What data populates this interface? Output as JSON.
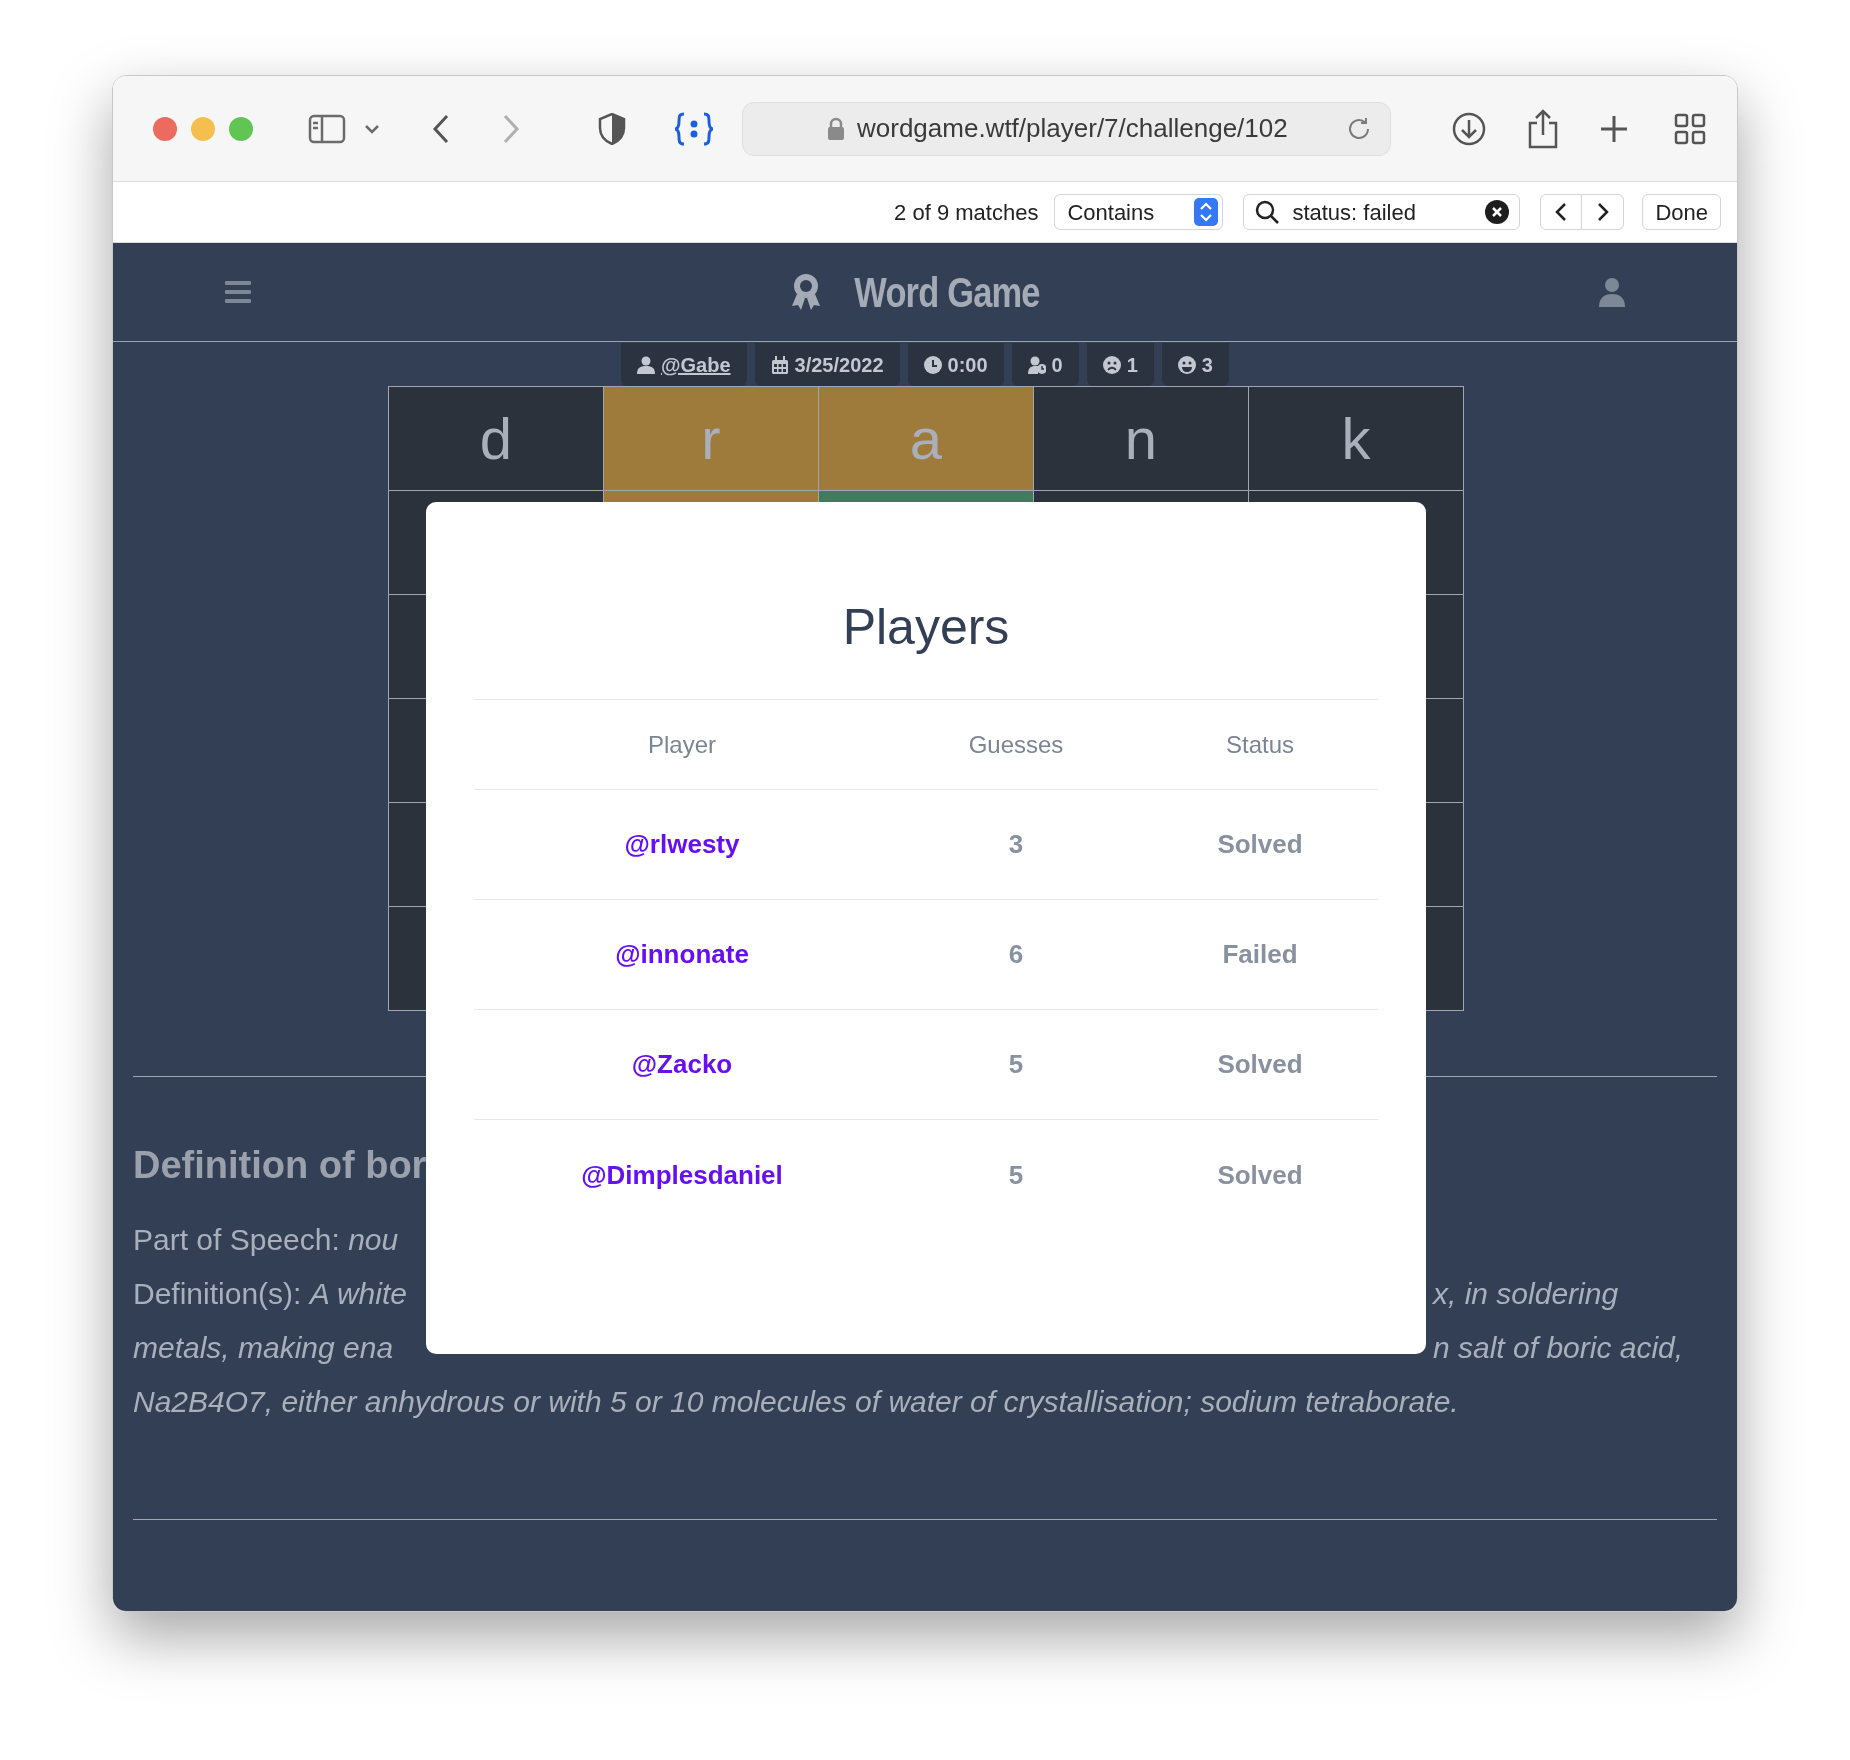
{
  "browser": {
    "url": "wordgame.wtf/player/7/challenge/102"
  },
  "find_bar": {
    "match_count": "2 of 9 matches",
    "mode": "Contains",
    "query": "status: failed",
    "done_label": "Done"
  },
  "app": {
    "title": "Word Game"
  },
  "stats": [
    {
      "kind": "player",
      "text": "@Gabe"
    },
    {
      "kind": "date",
      "text": "3/25/2022"
    },
    {
      "kind": "time",
      "text": "0:00"
    },
    {
      "kind": "waiting",
      "text": "0"
    },
    {
      "kind": "failed",
      "text": "1"
    },
    {
      "kind": "solved",
      "text": "3"
    }
  ],
  "board": {
    "rows": [
      {
        "tiles": [
          {
            "letter": "d",
            "color": "#2c323c"
          },
          {
            "letter": "r",
            "color": "#9e7b3b"
          },
          {
            "letter": "a",
            "color": "#9e7b3b"
          },
          {
            "letter": "n",
            "color": "#2c323c"
          },
          {
            "letter": "k",
            "color": "#2c323c"
          }
        ]
      },
      {
        "tiles": [
          {
            "color": "#2c323c"
          },
          {
            "color": "#9e7b3b"
          },
          {
            "color": "#44795c"
          },
          {
            "color": "#2c323c"
          },
          {
            "color": "#2c323c"
          }
        ]
      },
      {
        "edge_tiles": [
          {
            "color": "#2c323c"
          },
          {
            "color": "#2c323c"
          }
        ]
      },
      {
        "edge_tiles": [
          {
            "color": "#2c323c"
          },
          {
            "color": "#2c323c"
          }
        ]
      },
      {
        "edge_tiles": [
          {
            "color": "#2c323c"
          },
          {
            "color": "#2c323c"
          }
        ]
      },
      {
        "edge_tiles": [
          {
            "color": "#2c323c"
          },
          {
            "color": "#2c323c"
          }
        ]
      }
    ]
  },
  "definition": {
    "heading": "Definition of bor",
    "lines": [
      {
        "left": {
          "text": "Part of Speech: *nou*",
          "italic": false
        }
      },
      {
        "left": {
          "text": "Definition(s): *A white*",
          "italic": false
        },
        "right": {
          "text": "x, in soldering",
          "italic": true
        }
      },
      {
        "left": {
          "text": "metals, making ena",
          "italic": true
        },
        "right": {
          "text": "n salt of boric acid,",
          "italic": true
        }
      },
      {
        "left": {
          "text": "Na2B4O7, either anhydrous or with 5 or 10 molecules of water of crystallisation; sodium tetraborate.",
          "italic": true
        }
      }
    ]
  },
  "players_dialog": {
    "title": "Players",
    "columns": [
      "Player",
      "Guesses",
      "Status"
    ],
    "rows": [
      {
        "player": "@rlwesty",
        "guesses": "3",
        "status": "Solved"
      },
      {
        "player": "@innonate",
        "guesses": "6",
        "status": "Failed"
      },
      {
        "player": "@Zacko",
        "guesses": "5",
        "status": "Solved"
      },
      {
        "player": "@Dimplesdaniel",
        "guesses": "5",
        "status": "Solved"
      }
    ]
  }
}
